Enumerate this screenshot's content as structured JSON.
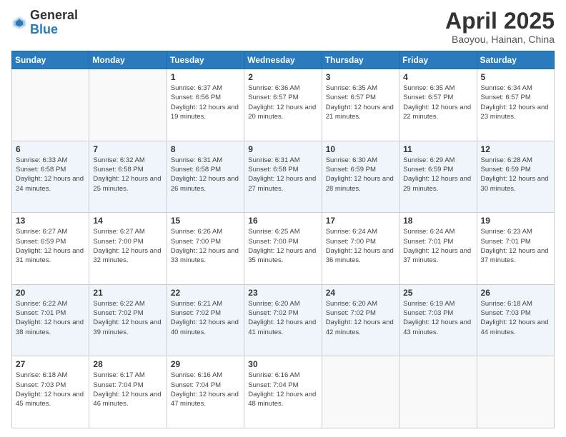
{
  "header": {
    "logo_general": "General",
    "logo_blue": "Blue",
    "month_title": "April 2025",
    "location": "Baoyou, Hainan, China"
  },
  "weekdays": [
    "Sunday",
    "Monday",
    "Tuesday",
    "Wednesday",
    "Thursday",
    "Friday",
    "Saturday"
  ],
  "weeks": [
    [
      {
        "day": "",
        "info": ""
      },
      {
        "day": "",
        "info": ""
      },
      {
        "day": "1",
        "info": "Sunrise: 6:37 AM\nSunset: 6:56 PM\nDaylight: 12 hours and 19 minutes."
      },
      {
        "day": "2",
        "info": "Sunrise: 6:36 AM\nSunset: 6:57 PM\nDaylight: 12 hours and 20 minutes."
      },
      {
        "day": "3",
        "info": "Sunrise: 6:35 AM\nSunset: 6:57 PM\nDaylight: 12 hours and 21 minutes."
      },
      {
        "day": "4",
        "info": "Sunrise: 6:35 AM\nSunset: 6:57 PM\nDaylight: 12 hours and 22 minutes."
      },
      {
        "day": "5",
        "info": "Sunrise: 6:34 AM\nSunset: 6:57 PM\nDaylight: 12 hours and 23 minutes."
      }
    ],
    [
      {
        "day": "6",
        "info": "Sunrise: 6:33 AM\nSunset: 6:58 PM\nDaylight: 12 hours and 24 minutes."
      },
      {
        "day": "7",
        "info": "Sunrise: 6:32 AM\nSunset: 6:58 PM\nDaylight: 12 hours and 25 minutes."
      },
      {
        "day": "8",
        "info": "Sunrise: 6:31 AM\nSunset: 6:58 PM\nDaylight: 12 hours and 26 minutes."
      },
      {
        "day": "9",
        "info": "Sunrise: 6:31 AM\nSunset: 6:58 PM\nDaylight: 12 hours and 27 minutes."
      },
      {
        "day": "10",
        "info": "Sunrise: 6:30 AM\nSunset: 6:59 PM\nDaylight: 12 hours and 28 minutes."
      },
      {
        "day": "11",
        "info": "Sunrise: 6:29 AM\nSunset: 6:59 PM\nDaylight: 12 hours and 29 minutes."
      },
      {
        "day": "12",
        "info": "Sunrise: 6:28 AM\nSunset: 6:59 PM\nDaylight: 12 hours and 30 minutes."
      }
    ],
    [
      {
        "day": "13",
        "info": "Sunrise: 6:27 AM\nSunset: 6:59 PM\nDaylight: 12 hours and 31 minutes."
      },
      {
        "day": "14",
        "info": "Sunrise: 6:27 AM\nSunset: 7:00 PM\nDaylight: 12 hours and 32 minutes."
      },
      {
        "day": "15",
        "info": "Sunrise: 6:26 AM\nSunset: 7:00 PM\nDaylight: 12 hours and 33 minutes."
      },
      {
        "day": "16",
        "info": "Sunrise: 6:25 AM\nSunset: 7:00 PM\nDaylight: 12 hours and 35 minutes."
      },
      {
        "day": "17",
        "info": "Sunrise: 6:24 AM\nSunset: 7:00 PM\nDaylight: 12 hours and 36 minutes."
      },
      {
        "day": "18",
        "info": "Sunrise: 6:24 AM\nSunset: 7:01 PM\nDaylight: 12 hours and 37 minutes."
      },
      {
        "day": "19",
        "info": "Sunrise: 6:23 AM\nSunset: 7:01 PM\nDaylight: 12 hours and 37 minutes."
      }
    ],
    [
      {
        "day": "20",
        "info": "Sunrise: 6:22 AM\nSunset: 7:01 PM\nDaylight: 12 hours and 38 minutes."
      },
      {
        "day": "21",
        "info": "Sunrise: 6:22 AM\nSunset: 7:02 PM\nDaylight: 12 hours and 39 minutes."
      },
      {
        "day": "22",
        "info": "Sunrise: 6:21 AM\nSunset: 7:02 PM\nDaylight: 12 hours and 40 minutes."
      },
      {
        "day": "23",
        "info": "Sunrise: 6:20 AM\nSunset: 7:02 PM\nDaylight: 12 hours and 41 minutes."
      },
      {
        "day": "24",
        "info": "Sunrise: 6:20 AM\nSunset: 7:02 PM\nDaylight: 12 hours and 42 minutes."
      },
      {
        "day": "25",
        "info": "Sunrise: 6:19 AM\nSunset: 7:03 PM\nDaylight: 12 hours and 43 minutes."
      },
      {
        "day": "26",
        "info": "Sunrise: 6:18 AM\nSunset: 7:03 PM\nDaylight: 12 hours and 44 minutes."
      }
    ],
    [
      {
        "day": "27",
        "info": "Sunrise: 6:18 AM\nSunset: 7:03 PM\nDaylight: 12 hours and 45 minutes."
      },
      {
        "day": "28",
        "info": "Sunrise: 6:17 AM\nSunset: 7:04 PM\nDaylight: 12 hours and 46 minutes."
      },
      {
        "day": "29",
        "info": "Sunrise: 6:16 AM\nSunset: 7:04 PM\nDaylight: 12 hours and 47 minutes."
      },
      {
        "day": "30",
        "info": "Sunrise: 6:16 AM\nSunset: 7:04 PM\nDaylight: 12 hours and 48 minutes."
      },
      {
        "day": "",
        "info": ""
      },
      {
        "day": "",
        "info": ""
      },
      {
        "day": "",
        "info": ""
      }
    ]
  ]
}
